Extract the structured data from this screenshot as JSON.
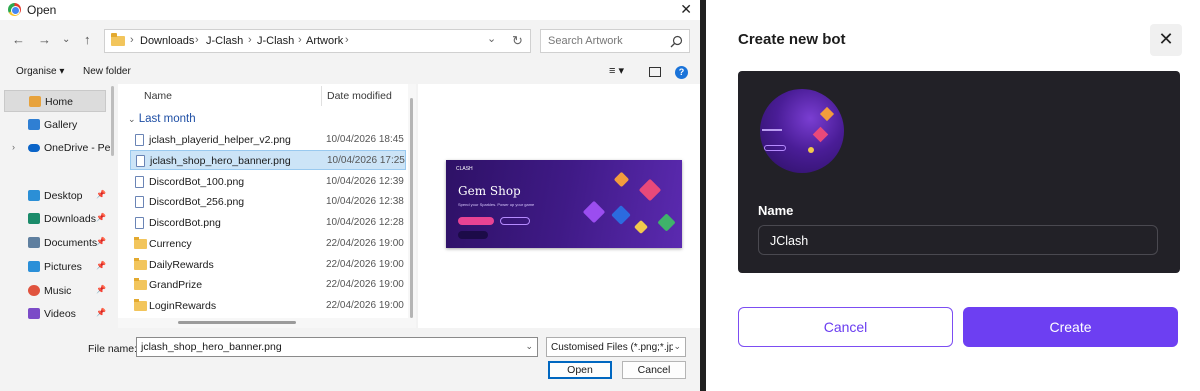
{
  "dialog": {
    "title": "Open",
    "close_glyph": "✕",
    "nav": {
      "back": "←",
      "forward": "→",
      "recent": "⌄",
      "up": "↑"
    },
    "breadcrumb": [
      "Downloads",
      "J-Clash",
      "J-Clash",
      "Artwork"
    ],
    "breadcrumb_sep": "›",
    "address_dropdown": "⌄",
    "refresh": "↻",
    "search": {
      "placeholder": "Search Artwork",
      "icon": "search-icon"
    },
    "toolbar": {
      "organise": "Organise ▾",
      "new_folder": "New folder",
      "view": "≡ ▾",
      "help": "?"
    },
    "sidebar": [
      {
        "label": "Home",
        "icon": "home-icon",
        "color": "#e7a23c",
        "selected": true
      },
      {
        "label": "Gallery",
        "icon": "gallery-icon",
        "color": "#2f7fd3"
      },
      {
        "label": "OneDrive - Per",
        "icon": "onedrive-icon",
        "color": "#0a64c8",
        "expand": "›"
      },
      {
        "label": "Desktop",
        "icon": "desktop-icon",
        "color": "#2b8fd6",
        "pin": "📌"
      },
      {
        "label": "Downloads",
        "icon": "downloads-icon",
        "color": "#1b8b6a",
        "pin": "📌"
      },
      {
        "label": "Documents",
        "icon": "documents-icon",
        "color": "#5f7f9f",
        "pin": "📌"
      },
      {
        "label": "Pictures",
        "icon": "pictures-icon",
        "color": "#2a8fd8",
        "pin": "📌"
      },
      {
        "label": "Music",
        "icon": "music-icon",
        "color": "#e0533e",
        "pin": "📌"
      },
      {
        "label": "Videos",
        "icon": "videos-icon",
        "color": "#7b4bc7",
        "pin": "📌"
      }
    ],
    "columns": {
      "name": "Name",
      "date": "Date modified"
    },
    "group_label": "Last month",
    "files": [
      {
        "name": "jclash_playerid_helper_v2.png",
        "date": "10/04/2026 18:45",
        "type": "file"
      },
      {
        "name": "jclash_shop_hero_banner.png",
        "date": "10/04/2026 17:25",
        "type": "file",
        "selected": true
      },
      {
        "name": "DiscordBot_100.png",
        "date": "10/04/2026 12:39",
        "type": "file"
      },
      {
        "name": "DiscordBot_256.png",
        "date": "10/04/2026 12:38",
        "type": "file"
      },
      {
        "name": "DiscordBot.png",
        "date": "10/04/2026 12:28",
        "type": "file"
      },
      {
        "name": "Currency",
        "date": "22/04/2026 19:00",
        "type": "folder"
      },
      {
        "name": "DailyRewards",
        "date": "22/04/2026 19:00",
        "type": "folder"
      },
      {
        "name": "GrandPrize",
        "date": "22/04/2026 19:00",
        "type": "folder"
      },
      {
        "name": "LoginRewards",
        "date": "22/04/2026 19:00",
        "type": "folder"
      }
    ],
    "preview": {
      "brand": "CLASH",
      "headline": "Gem Shop",
      "subtitle": "Spend your Sparkles. Power up your game"
    },
    "filename_label": "File name:",
    "filename_value": "jclash_shop_hero_banner.png",
    "filetype_value": "Customised Files (*.png;*.jpg",
    "dropdown_glyph": "⌄",
    "open_button": "Open",
    "cancel_button": "Cancel"
  },
  "bot_panel": {
    "title": "Create new bot",
    "close_glyph": "✕",
    "name_label": "Name",
    "name_value": "JClash",
    "cancel_button": "Cancel",
    "create_button": "Create",
    "accent_color": "#6d3ff2"
  }
}
